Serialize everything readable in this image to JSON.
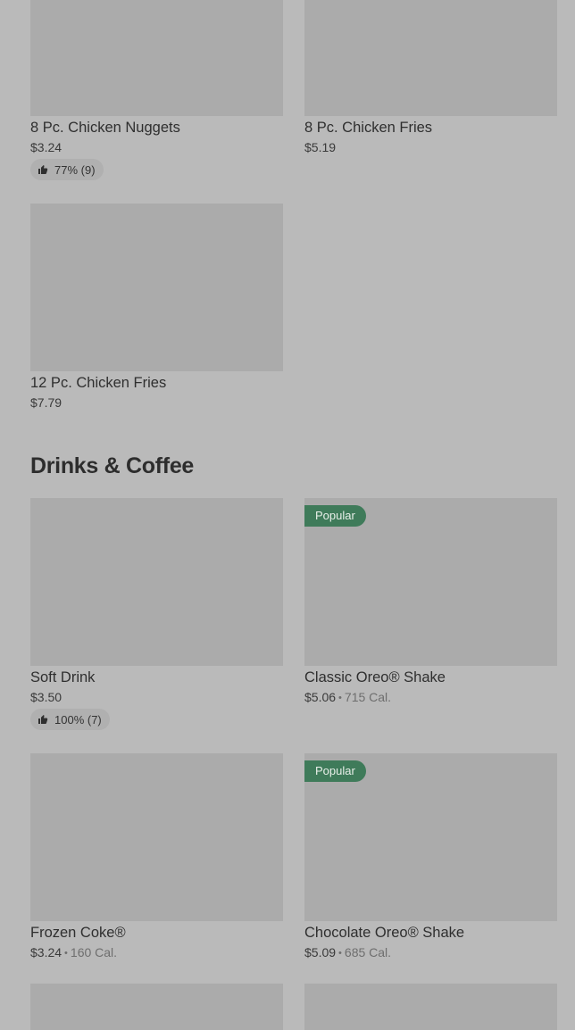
{
  "section_1": {
    "items": [
      {
        "name": "8 Pc. Chicken Nuggets",
        "price": "$3.24",
        "rating": "77% (9)"
      },
      {
        "name": "8 Pc. Chicken Fries",
        "price": "$5.19"
      },
      {
        "name": "12 Pc. Chicken Fries",
        "price": "$7.79"
      }
    ]
  },
  "drinks_section": {
    "title": "Drinks & Coffee",
    "items": [
      {
        "name": "Soft Drink",
        "price": "$3.50",
        "rating": "100% (7)"
      },
      {
        "name": "Classic Oreo® Shake",
        "price": "$5.06",
        "separator": "•",
        "calories": "715 Cal.",
        "badge": "Popular"
      },
      {
        "name": "Frozen Coke®",
        "price": "$3.24",
        "separator": "•",
        "calories": "160 Cal."
      },
      {
        "name": "Chocolate Oreo® Shake",
        "price": "$5.09",
        "separator": "•",
        "calories": "685 Cal.",
        "badge": "Popular"
      }
    ]
  },
  "colors": {
    "background": "#bababa",
    "image_placeholder": "#ababab",
    "badge_bg": "#3f7b5a",
    "rating_pill": "#b0b0b0"
  },
  "icons": {
    "rating": "thumbs-up-icon"
  }
}
